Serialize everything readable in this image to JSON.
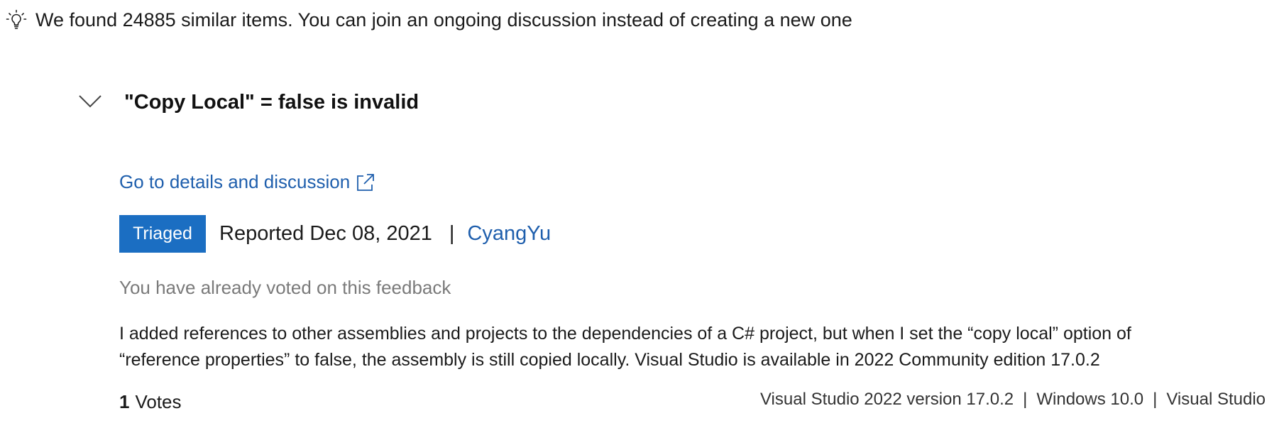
{
  "banner": {
    "icon": "lightbulb-icon",
    "text": "We found 24885 similar items. You can join an ongoing discussion instead of creating a new one"
  },
  "item": {
    "expand_icon": "chevron-down-icon",
    "title": "\"Copy Local\" = false is invalid",
    "details_link": {
      "label": "Go to details and discussion",
      "icon": "external-link-icon"
    },
    "status_badge": "Triaged",
    "reported_text": "Reported Dec 08, 2021",
    "separator": "|",
    "author": "CyangYu",
    "voted_note": "You have already voted on this feedback",
    "description_lines": [
      "I added references to other assemblies and projects to the dependencies of a C# project, but when I set the “copy local” option of",
      "“reference properties” to false, the assembly is still copied locally. Visual Studio is available in 2022 Community edition 17.0.2"
    ],
    "votes": {
      "count": "1",
      "label": "Votes"
    },
    "tags": [
      "Visual Studio 2022 version 17.0.2",
      "Windows 10.0",
      "Visual Studio"
    ],
    "tag_separator": "|"
  },
  "colors": {
    "accent": "#1b6ec2",
    "link": "#1f5fad",
    "muted_text": "#7a7a7a",
    "text": "#1b1b1b"
  }
}
